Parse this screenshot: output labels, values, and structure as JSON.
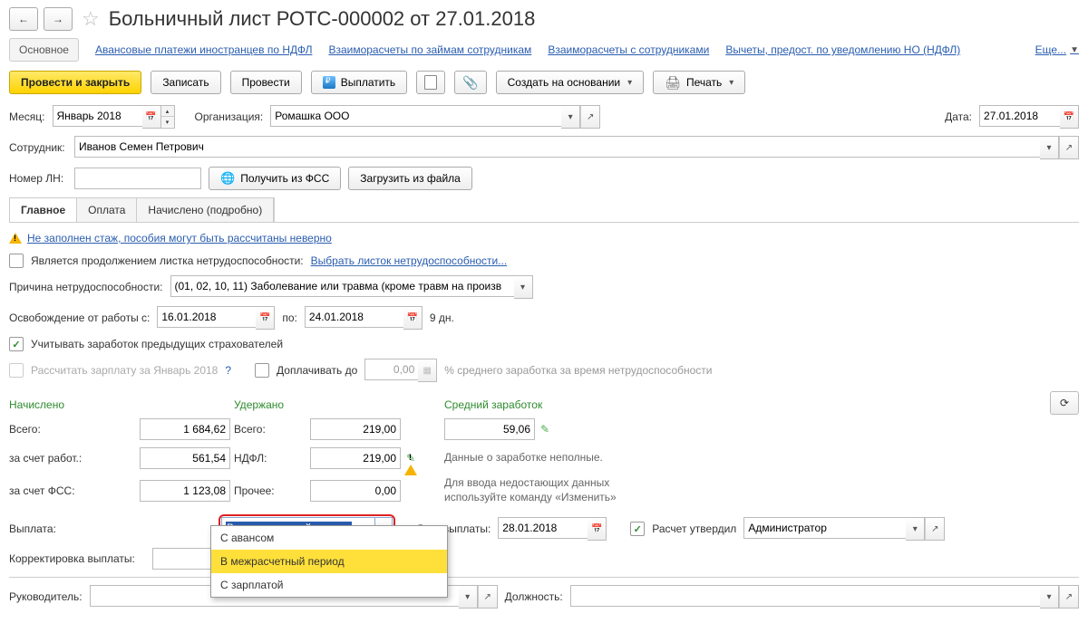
{
  "title": "Больничный лист РОТС-000002 от 27.01.2018",
  "subnav": {
    "main": "Основное",
    "links": [
      "Авансовые платежи иностранцев по НДФЛ",
      "Взаиморасчеты по займам сотрудникам",
      "Взаиморасчеты с сотрудниками",
      "Вычеты, предост. по уведомлению НО (НДФЛ)"
    ],
    "more": "Еще..."
  },
  "toolbar": {
    "post_close": "Провести и закрыть",
    "write": "Записать",
    "post": "Провести",
    "pay": "Выплатить",
    "create_based": "Создать на основании",
    "print": "Печать"
  },
  "form": {
    "month_label": "Месяц:",
    "month_value": "Январь 2018",
    "org_label": "Организация:",
    "org_value": "Ромашка ООО",
    "date_label": "Дата:",
    "date_value": "27.01.2018",
    "employee_label": "Сотрудник:",
    "employee_value": "Иванов Семен Петрович",
    "ln_label": "Номер ЛН:",
    "ln_value": "",
    "get_fss": "Получить из ФСС",
    "load_file": "Загрузить из файла"
  },
  "tabs": [
    "Главное",
    "Оплата",
    "Начислено (подробно)"
  ],
  "main": {
    "warn_text": "Не заполнен стаж, пособия могут быть рассчитаны неверно",
    "cont_label": "Является продолжением листка нетрудоспособности:",
    "cont_link": "Выбрать листок нетрудоспособности...",
    "reason_label": "Причина нетрудоспособности:",
    "reason_value": "(01, 02, 10, 11) Заболевание или травма (кроме травм на произв",
    "period_label": "Освобождение от работы с:",
    "date_from": "16.01.2018",
    "period_to": "по:",
    "date_to": "24.01.2018",
    "days": "9 дн.",
    "prev_ins": "Учитывать заработок предыдущих страхователей",
    "recalc_salary": "Рассчитать зарплату за Январь 2018",
    "toppay_label": "Доплачивать до",
    "toppay_value": "0,00",
    "toppay_tail": "% среднего заработка за время нетрудоспособности"
  },
  "calc": {
    "accrued": "Начислено",
    "withheld": "Удержано",
    "avg": "Средний заработок",
    "total_label": "Всего:",
    "total_val": "1 684,62",
    "w_total_label": "Всего:",
    "w_total_val": "219,00",
    "avg_val": "59,06",
    "emp_label": "за счет работ.:",
    "emp_val": "561,54",
    "ndfl_label": "НДФЛ:",
    "ndfl_val": "219,00",
    "fss_label": "за счет ФСС:",
    "fss_val": "1 123,08",
    "other_label": "Прочее:",
    "other_val": "0,00",
    "note1": "Данные о заработке неполные.",
    "note2": "Для ввода недостающих данных",
    "note3": "используйте команду «Изменить»"
  },
  "payout": {
    "label": "Выплата:",
    "value": "В межрасчетный период",
    "paydate_label": "Дата выплаты:",
    "paydate_value": "28.01.2018",
    "approved_label": "Расчет утвердил",
    "approved_by": "Администратор",
    "corr_label": "Корректировка выплаты:",
    "options": [
      "С авансом",
      "В межрасчетный период",
      "С зарплатой"
    ]
  },
  "footer": {
    "manager_label": "Руководитель:",
    "position_label": "Должность:"
  }
}
